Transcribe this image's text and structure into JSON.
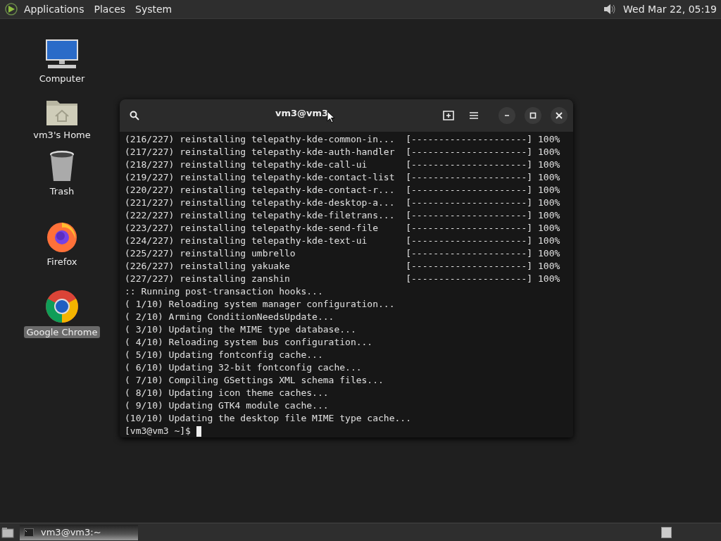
{
  "top_panel": {
    "menus": [
      "Applications",
      "Places",
      "System"
    ],
    "clock": "Wed Mar 22, 05:19"
  },
  "desktop_icons": [
    {
      "kind": "computer",
      "label": "Computer",
      "selected": false
    },
    {
      "kind": "home",
      "label": "vm3's Home",
      "selected": false
    },
    {
      "kind": "trash",
      "label": "Trash",
      "selected": false
    },
    {
      "kind": "firefox",
      "label": "Firefox",
      "selected": false
    },
    {
      "kind": "chrome",
      "label": "Google Chrome",
      "selected": true
    }
  ],
  "terminal": {
    "title": "vm3@vm3",
    "lines": [
      "(216/227) reinstalling telepathy-kde-common-in...  [---------------------] 100%",
      "(217/227) reinstalling telepathy-kde-auth-handler  [---------------------] 100%",
      "(218/227) reinstalling telepathy-kde-call-ui       [---------------------] 100%",
      "(219/227) reinstalling telepathy-kde-contact-list  [---------------------] 100%",
      "(220/227) reinstalling telepathy-kde-contact-r...  [---------------------] 100%",
      "(221/227) reinstalling telepathy-kde-desktop-a...  [---------------------] 100%",
      "(222/227) reinstalling telepathy-kde-filetrans...  [---------------------] 100%",
      "(223/227) reinstalling telepathy-kde-send-file     [---------------------] 100%",
      "(224/227) reinstalling telepathy-kde-text-ui       [---------------------] 100%",
      "(225/227) reinstalling umbrello                    [---------------------] 100%",
      "(226/227) reinstalling yakuake                     [---------------------] 100%",
      "(227/227) reinstalling zanshin                     [---------------------] 100%",
      ":: Running post-transaction hooks...",
      "( 1/10) Reloading system manager configuration...",
      "( 2/10) Arming ConditionNeedsUpdate...",
      "( 3/10) Updating the MIME type database...",
      "( 4/10) Reloading system bus configuration...",
      "( 5/10) Updating fontconfig cache...",
      "( 6/10) Updating 32-bit fontconfig cache...",
      "( 7/10) Compiling GSettings XML schema files...",
      "( 8/10) Updating icon theme caches...",
      "( 9/10) Updating GTK4 module cache...",
      "(10/10) Updating the desktop file MIME type cache..."
    ],
    "prompt": "[vm3@vm3 ~]$"
  },
  "taskbar": {
    "tasks": [
      {
        "label": "vm3@vm3:~",
        "selected": true
      }
    ]
  }
}
